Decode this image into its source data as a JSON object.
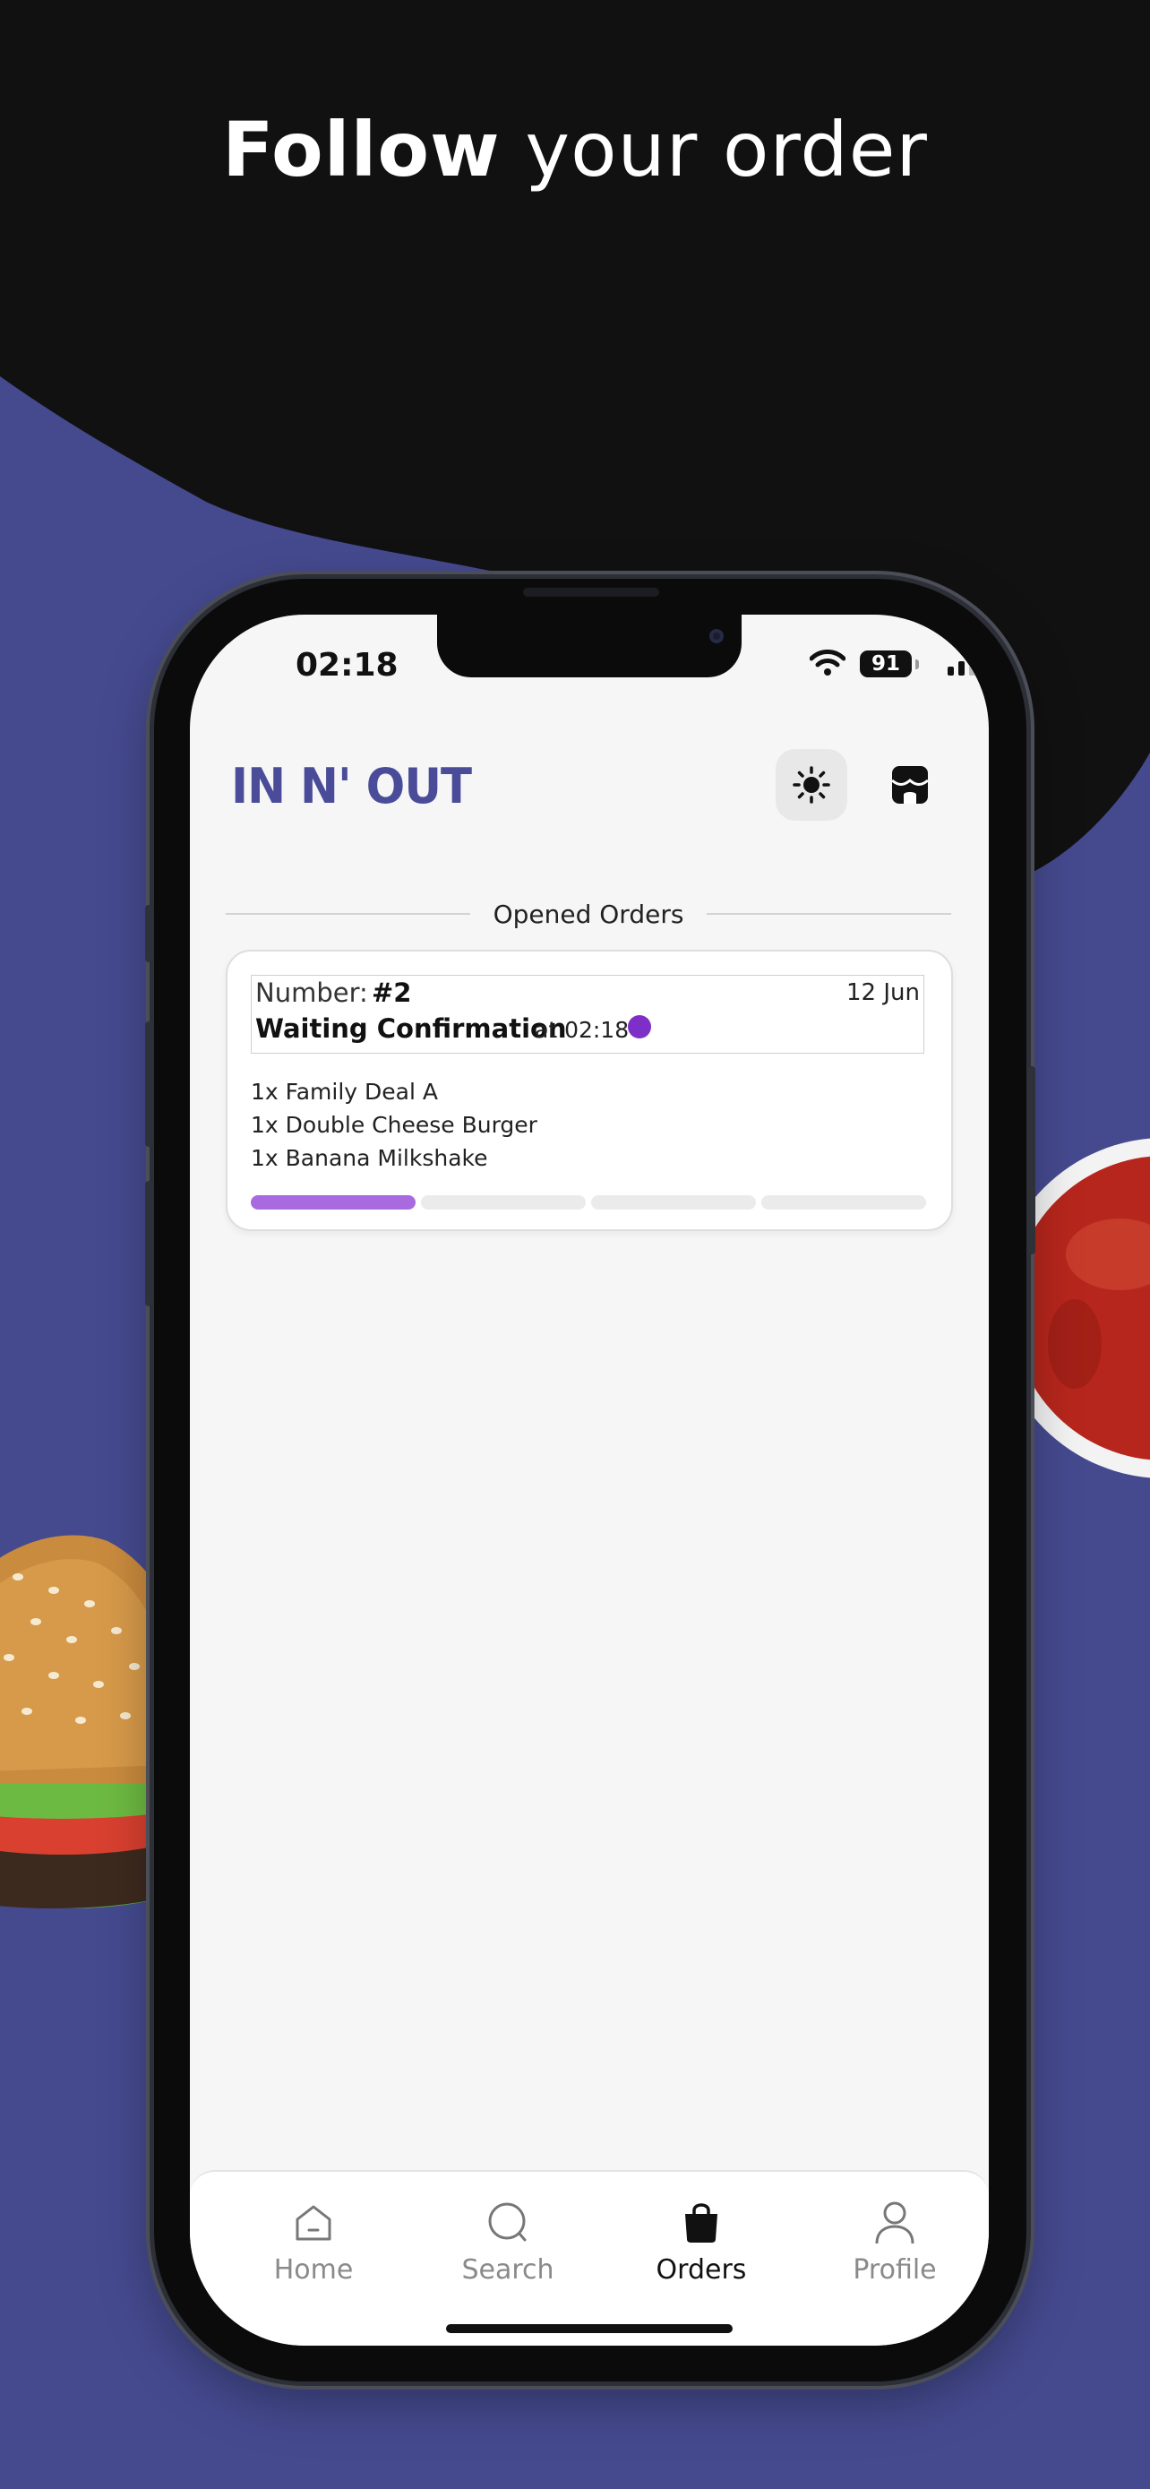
{
  "headline": {
    "bold": "Follow",
    "rest": "your order"
  },
  "status_bar": {
    "time": "02:18",
    "battery": "91"
  },
  "app": {
    "brand": "IN N' OUT",
    "brand_color": "#4a4c99",
    "theme_toggle_icon": "sun-icon",
    "store_icon": "store-icon"
  },
  "section": {
    "title": "Opened Orders"
  },
  "order": {
    "number_label": "Number:",
    "number": "#2",
    "date": "12 Jun",
    "status": "Waiting Confirmation",
    "status_time": "at 02:18",
    "status_color": "#7d2fc8",
    "items": [
      "1x Family Deal A",
      "1x Double Cheese Burger",
      "1x Banana Milkshake"
    ],
    "progress": {
      "completed_steps": 1,
      "total_steps": 4,
      "fill_color": "#a96ae0"
    }
  },
  "tabbar": {
    "tabs": [
      {
        "label": "Home",
        "icon": "home-icon",
        "active": false
      },
      {
        "label": "Search",
        "icon": "search-icon",
        "active": false
      },
      {
        "label": "Orders",
        "icon": "shopping-bag-icon",
        "active": true
      },
      {
        "label": "Profile",
        "icon": "user-icon",
        "active": false
      }
    ]
  },
  "colors": {
    "background_blue": "#454a8f",
    "background_black": "#111111",
    "screen_bg": "#f6f6f6"
  }
}
